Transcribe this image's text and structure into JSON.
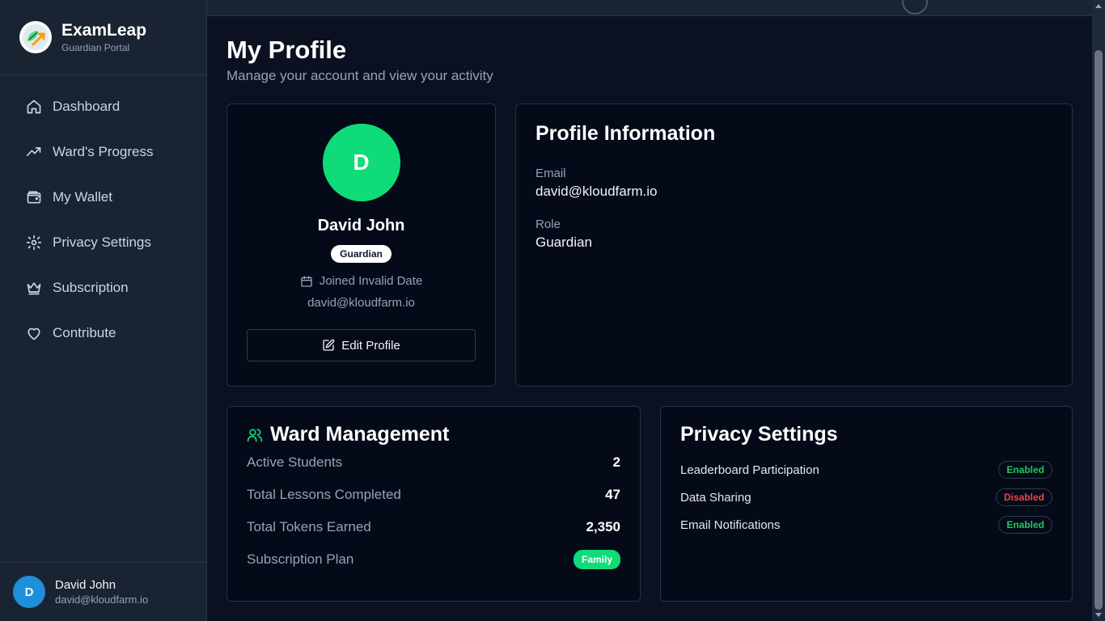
{
  "app": {
    "name": "ExamLeap",
    "subtitle": "Guardian Portal"
  },
  "sidebar": {
    "items": [
      {
        "label": "Dashboard",
        "icon": "home-icon"
      },
      {
        "label": "Ward's Progress",
        "icon": "trending-up-icon"
      },
      {
        "label": "My Wallet",
        "icon": "wallet-icon"
      },
      {
        "label": "Privacy Settings",
        "icon": "gear-icon"
      },
      {
        "label": "Subscription",
        "icon": "crown-icon"
      },
      {
        "label": "Contribute",
        "icon": "heart-icon"
      }
    ],
    "user": {
      "initial": "D",
      "name": "David John",
      "email": "david@kloudfarm.io"
    }
  },
  "page": {
    "title": "My Profile",
    "subtitle": "Manage your account and view your activity"
  },
  "profile": {
    "initial": "D",
    "name": "David John",
    "role_badge": "Guardian",
    "joined": "Joined Invalid Date",
    "email": "david@kloudfarm.io",
    "edit_label": "Edit Profile"
  },
  "info": {
    "title": "Profile Information",
    "email_label": "Email",
    "email_value": "david@kloudfarm.io",
    "role_label": "Role",
    "role_value": "Guardian"
  },
  "ward": {
    "title": "Ward Management",
    "stats": [
      {
        "label": "Active Students",
        "value": "2"
      },
      {
        "label": "Total Lessons Completed",
        "value": "47"
      },
      {
        "label": "Total Tokens Earned",
        "value": "2,350"
      }
    ],
    "plan_label": "Subscription Plan",
    "plan_value": "Family"
  },
  "privacy": {
    "title": "Privacy Settings",
    "items": [
      {
        "label": "Leaderboard Participation",
        "status": "Enabled"
      },
      {
        "label": "Data Sharing",
        "status": "Disabled"
      },
      {
        "label": "Email Notifications",
        "status": "Enabled"
      }
    ]
  },
  "colors": {
    "accent": "#0fdc78",
    "avatar_blue": "#1d8fdb",
    "enabled": "#22c55e",
    "disabled": "#ef4444"
  }
}
